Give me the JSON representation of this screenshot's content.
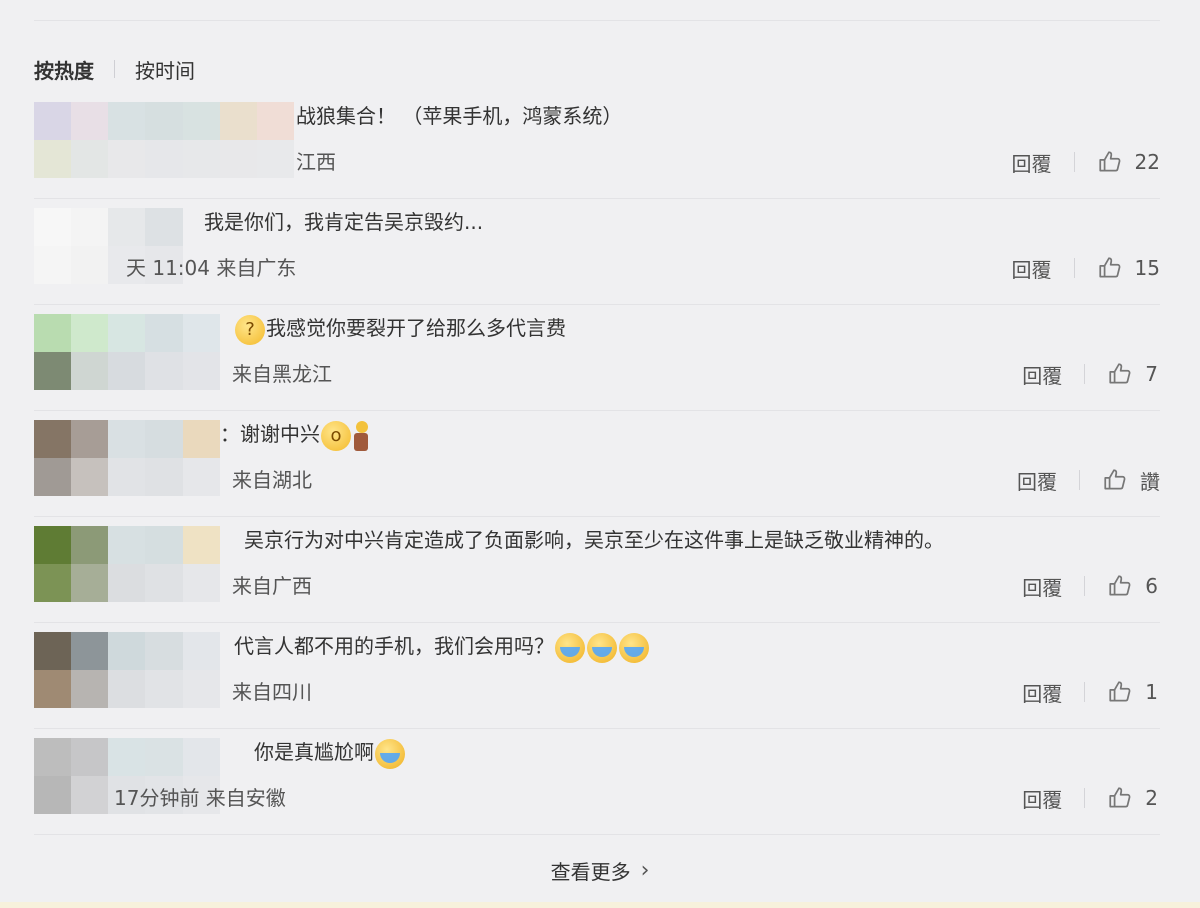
{
  "sort": {
    "active": "按热度",
    "other": "按时间"
  },
  "comments": [
    {
      "text": "战狼集合！ （苹果手机，鸿蒙系统）",
      "meta": "江西",
      "reply": "回覆",
      "likes": "22",
      "mosaic": [
        "#d9d6e6",
        "#e8dfe6",
        "#d8e1e3",
        "#d6dfe0",
        "#d8e2e1",
        "#eadfcd",
        "#f0ddd6",
        "#e4e6d6",
        "#e3e6e5",
        "#e8e8ea",
        "#e6e7ea",
        "#e7e8ea",
        "#e8e8ea",
        "#e8e9eb"
      ]
    },
    {
      "text": "我是你们，我肯定告吴京毁约...",
      "meta": "天 11:04 来自广东",
      "reply": "回覆",
      "likes": "15",
      "mosaic": [
        "#f7f7f7",
        "#f4f4f4",
        "#e6e8ea",
        "#dde1e4",
        "#f0f0f2",
        "#f0f0f2",
        "#f0f0f2",
        "#f5f5f5",
        "#f2f2f2",
        "#e8e9ec",
        "#e6e7ea",
        "#f0f0f2",
        "#f0f0f2",
        "#f0f0f2"
      ]
    },
    {
      "text": "我感觉你要裂开了给那么多代言费",
      "meta": "来自黑龙江",
      "reply": "回覆",
      "likes": "7",
      "mosaic": [
        "#b9dcb0",
        "#cfe9cc",
        "#d7e6e2",
        "#d6dfe2",
        "#dfe6ea",
        "#f0f0f2",
        "#f0f0f2",
        "#7d8a73",
        "#cfd6d2",
        "#d7dbdf",
        "#dfe1e5",
        "#e3e4e8",
        "#f0f0f2",
        "#f0f0f2"
      ]
    },
    {
      "text": "：谢谢中兴",
      "meta": "来自湖北",
      "reply": "回覆",
      "likes": "讚",
      "mosaic": [
        "#857565",
        "#a79d96",
        "#d9e0e3",
        "#d6dde0",
        "#ead9bd",
        "#f0f0f2",
        "#f0f0f2",
        "#a09a95",
        "#c6c1bd",
        "#e1e3e6",
        "#dfe1e4",
        "#e6e7ea",
        "#f0f0f2",
        "#f0f0f2"
      ]
    },
    {
      "text": "吴京行为对中兴肯定造成了负面影响，吴京至少在这件事上是缺乏敬业精神的。",
      "meta": "来自广西",
      "reply": "回覆",
      "likes": "6",
      "mosaic": [
        "#5f7c34",
        "#8c9a77",
        "#d7e0e2",
        "#d5dee0",
        "#efe2c4",
        "#f0f0f2",
        "#f0f0f2",
        "#7c9355",
        "#a6ae97",
        "#dbdde0",
        "#dfe1e4",
        "#e6e7ea",
        "#f0f0f2",
        "#f0f0f2"
      ]
    },
    {
      "text": "代言人都不用的手机，我们会用吗？",
      "meta": "来自四川",
      "reply": "回覆",
      "likes": "1",
      "mosaic": [
        "#6d6456",
        "#8d9599",
        "#cfd9dc",
        "#d7dde0",
        "#e3e6ea",
        "#f0f0f2",
        "#f0f0f2",
        "#9f8a73",
        "#b7b4b1",
        "#dcdee1",
        "#e1e3e6",
        "#e6e7ea",
        "#f0f0f2",
        "#f0f0f2"
      ]
    },
    {
      "text": "你是真尴尬啊",
      "meta": "17分钟前 来自安徽",
      "reply": "回覆",
      "likes": "2",
      "mosaic": [
        "#bdbdbd",
        "#c6c6c8",
        "#d9e3e5",
        "#dae2e4",
        "#e3e6ea",
        "#f0f0f2",
        "#f0f0f2",
        "#b7b7b7",
        "#d2d2d4",
        "#e0e2e5",
        "#e2e4e7",
        "#e6e7ea",
        "#f0f0f2",
        "#f0f0f2"
      ]
    }
  ],
  "more": {
    "label": "查看更多"
  },
  "icons": {
    "like": "thumbs-up-icon",
    "chevron": "chevron-right-icon"
  }
}
